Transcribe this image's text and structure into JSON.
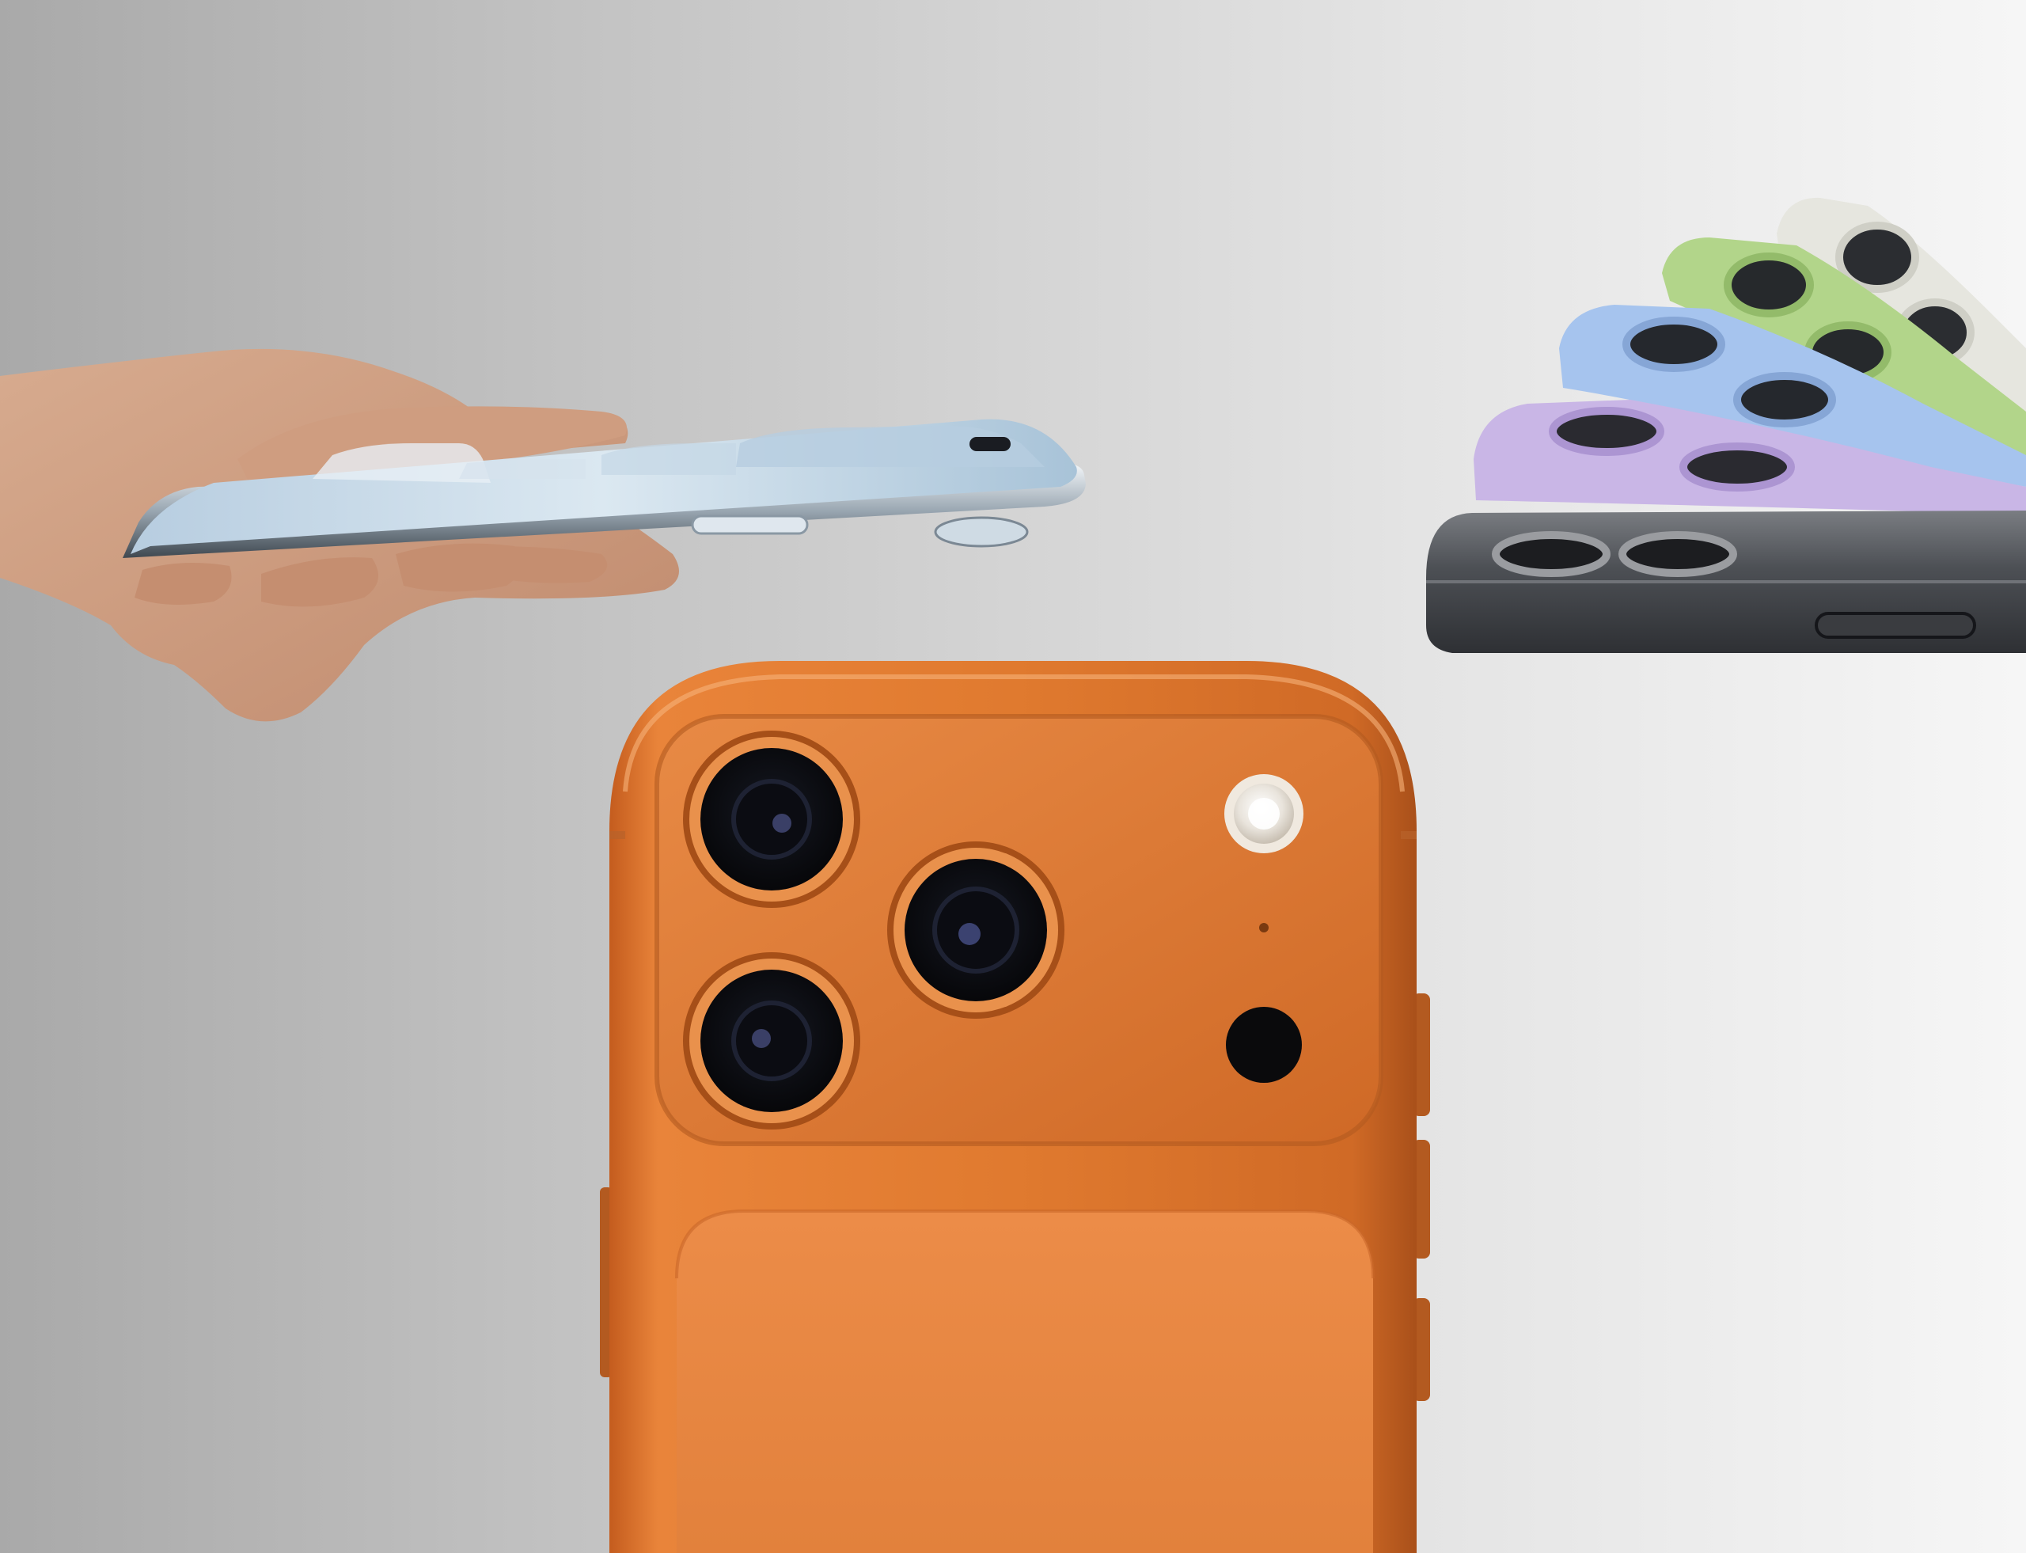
{
  "scene": {
    "subjects": [
      "hand-holding-slim-phone-icon",
      "orange-phone-rear-camera-icon",
      "fanned-phone-color-lineup-icon"
    ],
    "colors": {
      "background_left": "#a9a9a9",
      "background_right": "#f6f6f6",
      "orange_body": "#e07a2f",
      "slim_phone_blue": "#c9dbe8",
      "lineup": [
        "#6f7276",
        "#c9b6e6",
        "#a6c4ee",
        "#b2d58a",
        "#e6e6df"
      ]
    }
  }
}
